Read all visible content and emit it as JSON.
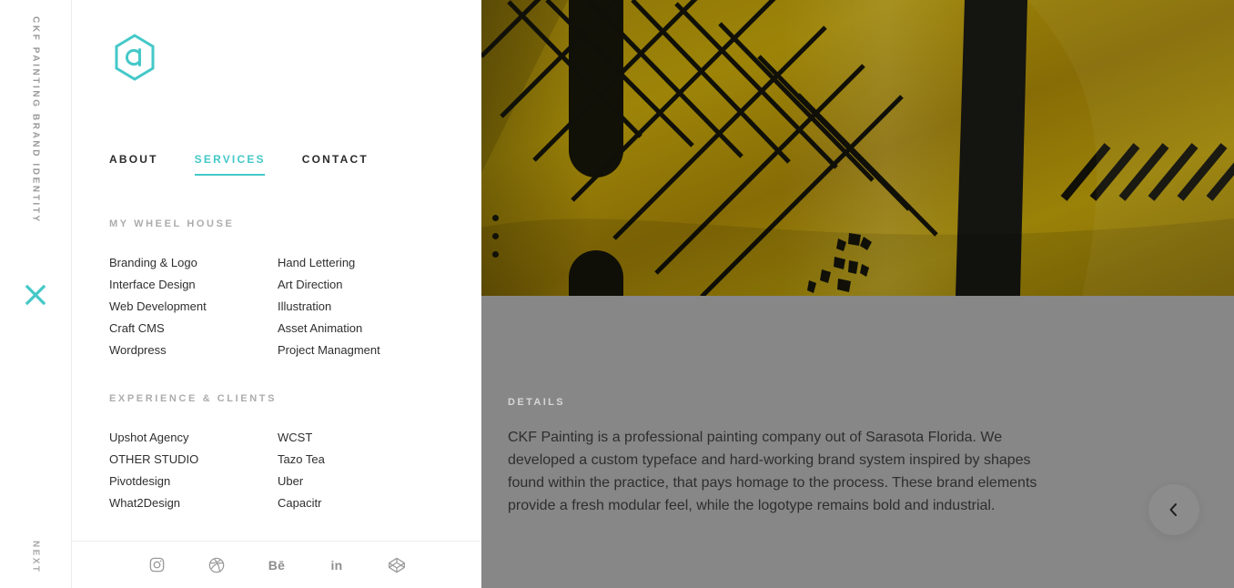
{
  "rail": {
    "project_title": "CKF PAINTING BRAND IDENTITY",
    "close_icon": "close-x-icon",
    "next_label": "NEXT"
  },
  "panel": {
    "logo_icon": "hexagon-a-logo",
    "nav": [
      {
        "label": "ABOUT",
        "active": false
      },
      {
        "label": "SERVICES",
        "active": true
      },
      {
        "label": "CONTACT",
        "active": false
      }
    ],
    "sections": [
      {
        "heading": "MY WHEEL HOUSE",
        "col1": [
          "Branding & Logo",
          "Interface Design",
          "Web Development",
          "Craft CMS",
          "Wordpress"
        ],
        "col2": [
          "Hand Lettering",
          "Art Direction",
          "Illustration",
          "Asset Animation",
          "Project Managment"
        ]
      },
      {
        "heading": "EXPERIENCE & CLIENTS",
        "col1": [
          "Upshot Agency",
          "OTHER STUDIO",
          "Pivotdesign",
          "What2Design"
        ],
        "col2": [
          "WCST",
          "Tazo Tea",
          "Uber",
          "Capacitr"
        ]
      }
    ],
    "social": [
      {
        "icon": "instagram-icon",
        "label": ""
      },
      {
        "icon": "dribbble-icon",
        "label": ""
      },
      {
        "icon": "behance-icon",
        "label": "Bē"
      },
      {
        "icon": "linkedin-icon",
        "label": "in"
      },
      {
        "icon": "codepen-icon",
        "label": ""
      }
    ]
  },
  "content": {
    "slider": {
      "dot_count": 3,
      "image_alt": "ckf-painting-yellow-fabric-brand-photo"
    },
    "details_label": "DETAILS",
    "details_body": "CKF Painting is a professional painting company out of Sarasota Florida. We developed a custom typeface and hard-working brand system inspired by shapes found within the practice, that pays homage to the process. These brand elements provide a fresh modular feel, while the logotype remains bold and industrial.",
    "prev_icon": "chevron-left-icon"
  },
  "colors": {
    "accent_teal": "#45c8c8",
    "overlay_gray": "#878787",
    "hero_yellow": "#8c7208",
    "hero_black": "#111108",
    "text_dark": "#2f2f2f",
    "muted_gray": "#acacac"
  }
}
